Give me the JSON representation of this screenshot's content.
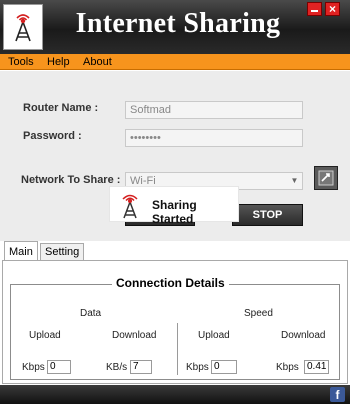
{
  "window": {
    "title": "Internet Sharing",
    "minimize_icon": "minimize-icon",
    "close_icon": "close-icon",
    "close_glyph": "×"
  },
  "menu": {
    "items": [
      {
        "label": "Tools"
      },
      {
        "label": "Help"
      },
      {
        "label": "About"
      }
    ]
  },
  "form": {
    "router_name_label": "Router Name :",
    "router_name_value": "Softmad",
    "password_label": "Password :",
    "password_value": "••••••••",
    "network_label": "Network To Share :",
    "network_value": "Wi-Fi",
    "stop_label": "STOP",
    "refresh_icon": "refresh-icon"
  },
  "toast": {
    "text": "Sharing Started",
    "icon": "tower-icon"
  },
  "tabs": [
    {
      "label": "Main",
      "active": true
    },
    {
      "label": "Setting",
      "active": false
    }
  ],
  "connection": {
    "title": "Connection Details",
    "data": {
      "heading": "Data",
      "upload_label": "Upload",
      "download_label": "Download",
      "upload_unit": "Kbps",
      "upload_value": "0",
      "download_unit": "KB/s",
      "download_value": "7"
    },
    "speed": {
      "heading": "Speed",
      "upload_label": "Upload",
      "download_label": "Download",
      "upload_unit": "Kbps",
      "upload_value": "0",
      "download_unit": "Kbps",
      "download_value": "0.41"
    }
  },
  "footer": {
    "facebook_glyph": "f",
    "facebook_icon": "facebook-icon"
  },
  "colors": {
    "accent_orange": "#f7941d",
    "title_bar": "#1a1a1a",
    "close_red": "#e02222",
    "facebook_blue": "#3b5998"
  }
}
